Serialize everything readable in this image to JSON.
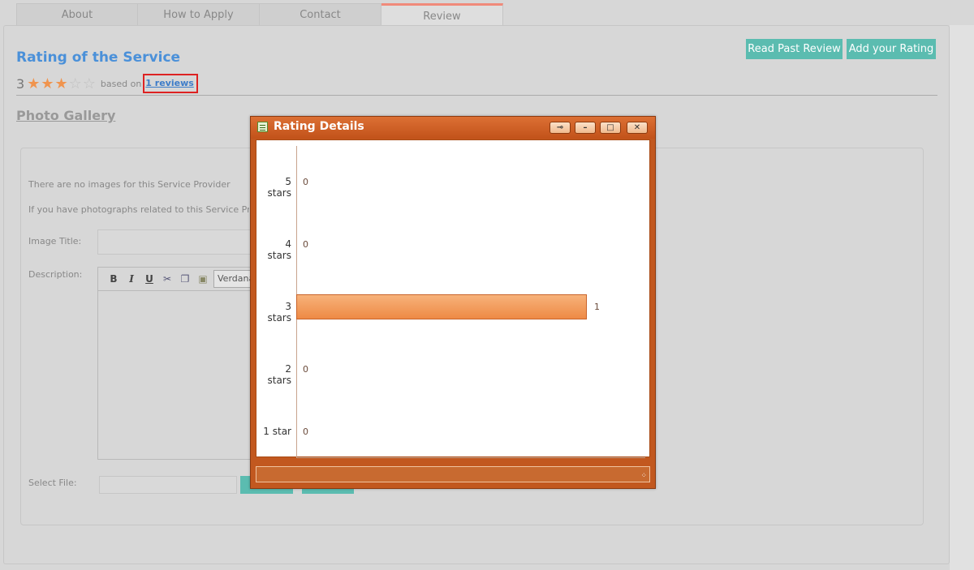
{
  "tabs": [
    "About",
    "How to Apply",
    "Contact",
    "Review"
  ],
  "rating": {
    "title": "Rating of the Service",
    "score": "3",
    "stars_filled": 3,
    "stars_total": 5,
    "based_on": "based on",
    "reviews_link": "1 reviews"
  },
  "buttons": {
    "read_past": "Read Past Review",
    "add_rating": "Add your Rating"
  },
  "gallery": {
    "title": "Photo Gallery",
    "no_images": "There are no images for this Service Provider",
    "if_you_have": "If you have photographs related to this Service Provider",
    "image_title_label": "Image Title:",
    "description_label": "Description:",
    "select_file_label": "Select File:",
    "font_value": "Verdana"
  },
  "dialog": {
    "title": "Rating Details"
  },
  "chart_data": {
    "type": "bar",
    "orientation": "horizontal",
    "categories": [
      "5 stars",
      "4 stars",
      "3 stars",
      "2 stars",
      "1 star"
    ],
    "values": [
      0,
      0,
      1,
      0,
      0
    ],
    "xlim": [
      0,
      1.2
    ],
    "bar_color": "#ee8a45"
  },
  "colors": {
    "accent_teal": "#5bbcb0",
    "title_blue": "#4a90d9",
    "dialog_orange": "#c2581f",
    "highlight_red": "#dd2222"
  }
}
